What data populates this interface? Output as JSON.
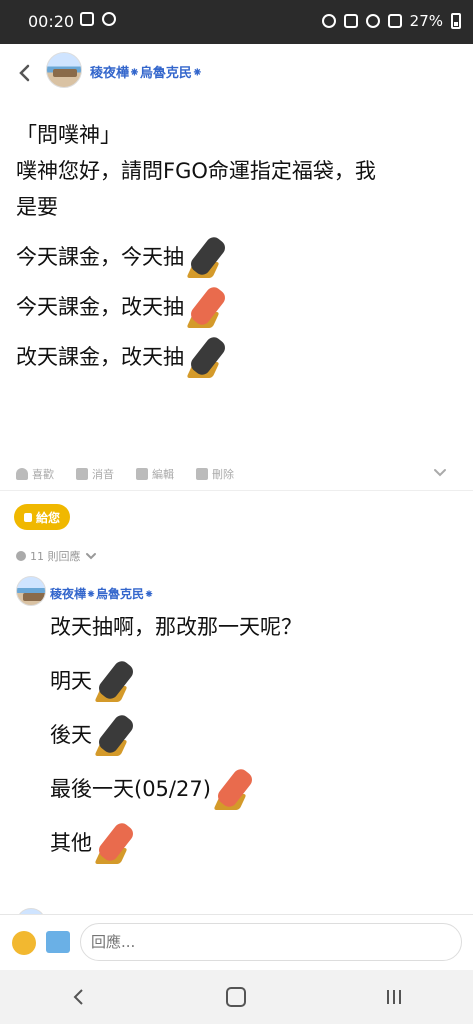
{
  "status_bar": {
    "time": "00:20",
    "battery": "27%",
    "left_icons": [
      "image-icon",
      "gear-icon"
    ],
    "right_icons": [
      "alarm-icon",
      "mute-icon",
      "wifi-icon",
      "volte-icon",
      "signal-icon",
      "battery-icon"
    ]
  },
  "header": {
    "poster_name": "稜夜樺⁕烏魯克民⁕"
  },
  "post": {
    "lines": [
      "「問噗神」",
      "噗神您好，請問FGO命運指定福袋，我",
      "是要"
    ],
    "options": [
      {
        "text": "今天課金，今天抽",
        "stick": "black"
      },
      {
        "text": "今天課金，改天抽",
        "stick": "red"
      },
      {
        "text": "改天課金，改天抽",
        "stick": "black"
      }
    ],
    "actions": [
      "喜歡",
      "消音",
      "編輯",
      "刪除"
    ]
  },
  "give_button": "給您",
  "replies_count": "11 則回應",
  "comment": {
    "author": "稜夜樺⁕烏魯克民⁕",
    "lines": [
      {
        "text": "改天抽啊，那改那一天呢？",
        "stick": ""
      },
      {
        "text": "明天",
        "stick": "black"
      },
      {
        "text": "後天",
        "stick": "black"
      },
      {
        "text": "最後一天(05/27)",
        "stick": "red"
      },
      {
        "text": "其他",
        "stick": "red"
      }
    ]
  },
  "compose": {
    "placeholder": "回應..."
  }
}
